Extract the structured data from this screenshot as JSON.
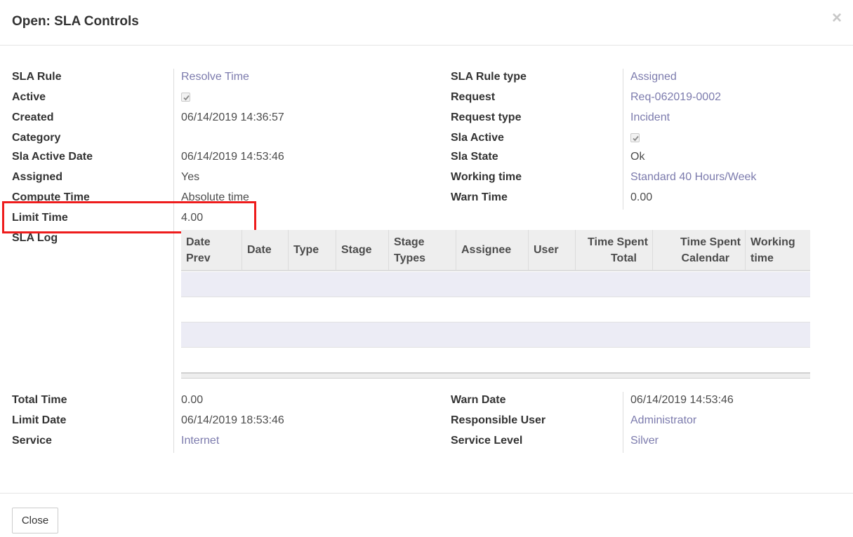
{
  "dialog": {
    "title": "Open: SLA Controls",
    "close_symbol": "×"
  },
  "left": {
    "sla_rule": {
      "label": "SLA Rule",
      "value": "Resolve Time"
    },
    "active": {
      "label": "Active",
      "checked": true
    },
    "created": {
      "label": "Created",
      "value": "06/14/2019 14:36:57"
    },
    "category": {
      "label": "Category",
      "value": ""
    },
    "sla_active_date": {
      "label": "Sla Active Date",
      "value": "06/14/2019 14:53:46"
    },
    "assigned": {
      "label": "Assigned",
      "value": "Yes"
    },
    "compute_time": {
      "label": "Compute Time",
      "value": "Absolute time"
    },
    "limit_time": {
      "label": "Limit Time",
      "value": "4.00"
    },
    "sla_log": {
      "label": "SLA Log"
    }
  },
  "right": {
    "sla_rule_type": {
      "label": "SLA Rule type",
      "value": "Assigned"
    },
    "request": {
      "label": "Request",
      "value": "Req-062019-0002"
    },
    "request_type": {
      "label": "Request type",
      "value": "Incident"
    },
    "sla_active": {
      "label": "Sla Active",
      "checked": true
    },
    "sla_state": {
      "label": "Sla State",
      "value": "Ok"
    },
    "working_time": {
      "label": "Working time",
      "value": "Standard 40 Hours/Week"
    },
    "warn_time": {
      "label": "Warn Time",
      "value": "0.00"
    }
  },
  "sla_log_table": {
    "columns": [
      {
        "line1": "Date",
        "line2": "Prev"
      },
      {
        "line1": "Date",
        "line2": ""
      },
      {
        "line1": "Type",
        "line2": ""
      },
      {
        "line1": "Stage",
        "line2": ""
      },
      {
        "line1": "Stage",
        "line2": "Types"
      },
      {
        "line1": "Assignee",
        "line2": ""
      },
      {
        "line1": "User",
        "line2": ""
      },
      {
        "line1": "Time Spent",
        "line2": "Total"
      },
      {
        "line1": "Time Spent",
        "line2": "Calendar"
      },
      {
        "line1": "Working",
        "line2": "time"
      }
    ],
    "rows": []
  },
  "bottom_left": {
    "total_time": {
      "label": "Total Time",
      "value": "0.00"
    },
    "limit_date": {
      "label": "Limit Date",
      "value": "06/14/2019 18:53:46"
    },
    "service": {
      "label": "Service",
      "value": "Internet"
    }
  },
  "bottom_right": {
    "warn_date": {
      "label": "Warn Date",
      "value": "06/14/2019 14:53:46"
    },
    "responsible_user": {
      "label": "Responsible User",
      "value": "Administrator"
    },
    "service_level": {
      "label": "Service Level",
      "value": "Silver"
    }
  },
  "footer": {
    "close_label": "Close"
  },
  "colors": {
    "link": "#7c7bad",
    "highlight": "#ee1c1c",
    "row_alt": "#ececf5"
  }
}
